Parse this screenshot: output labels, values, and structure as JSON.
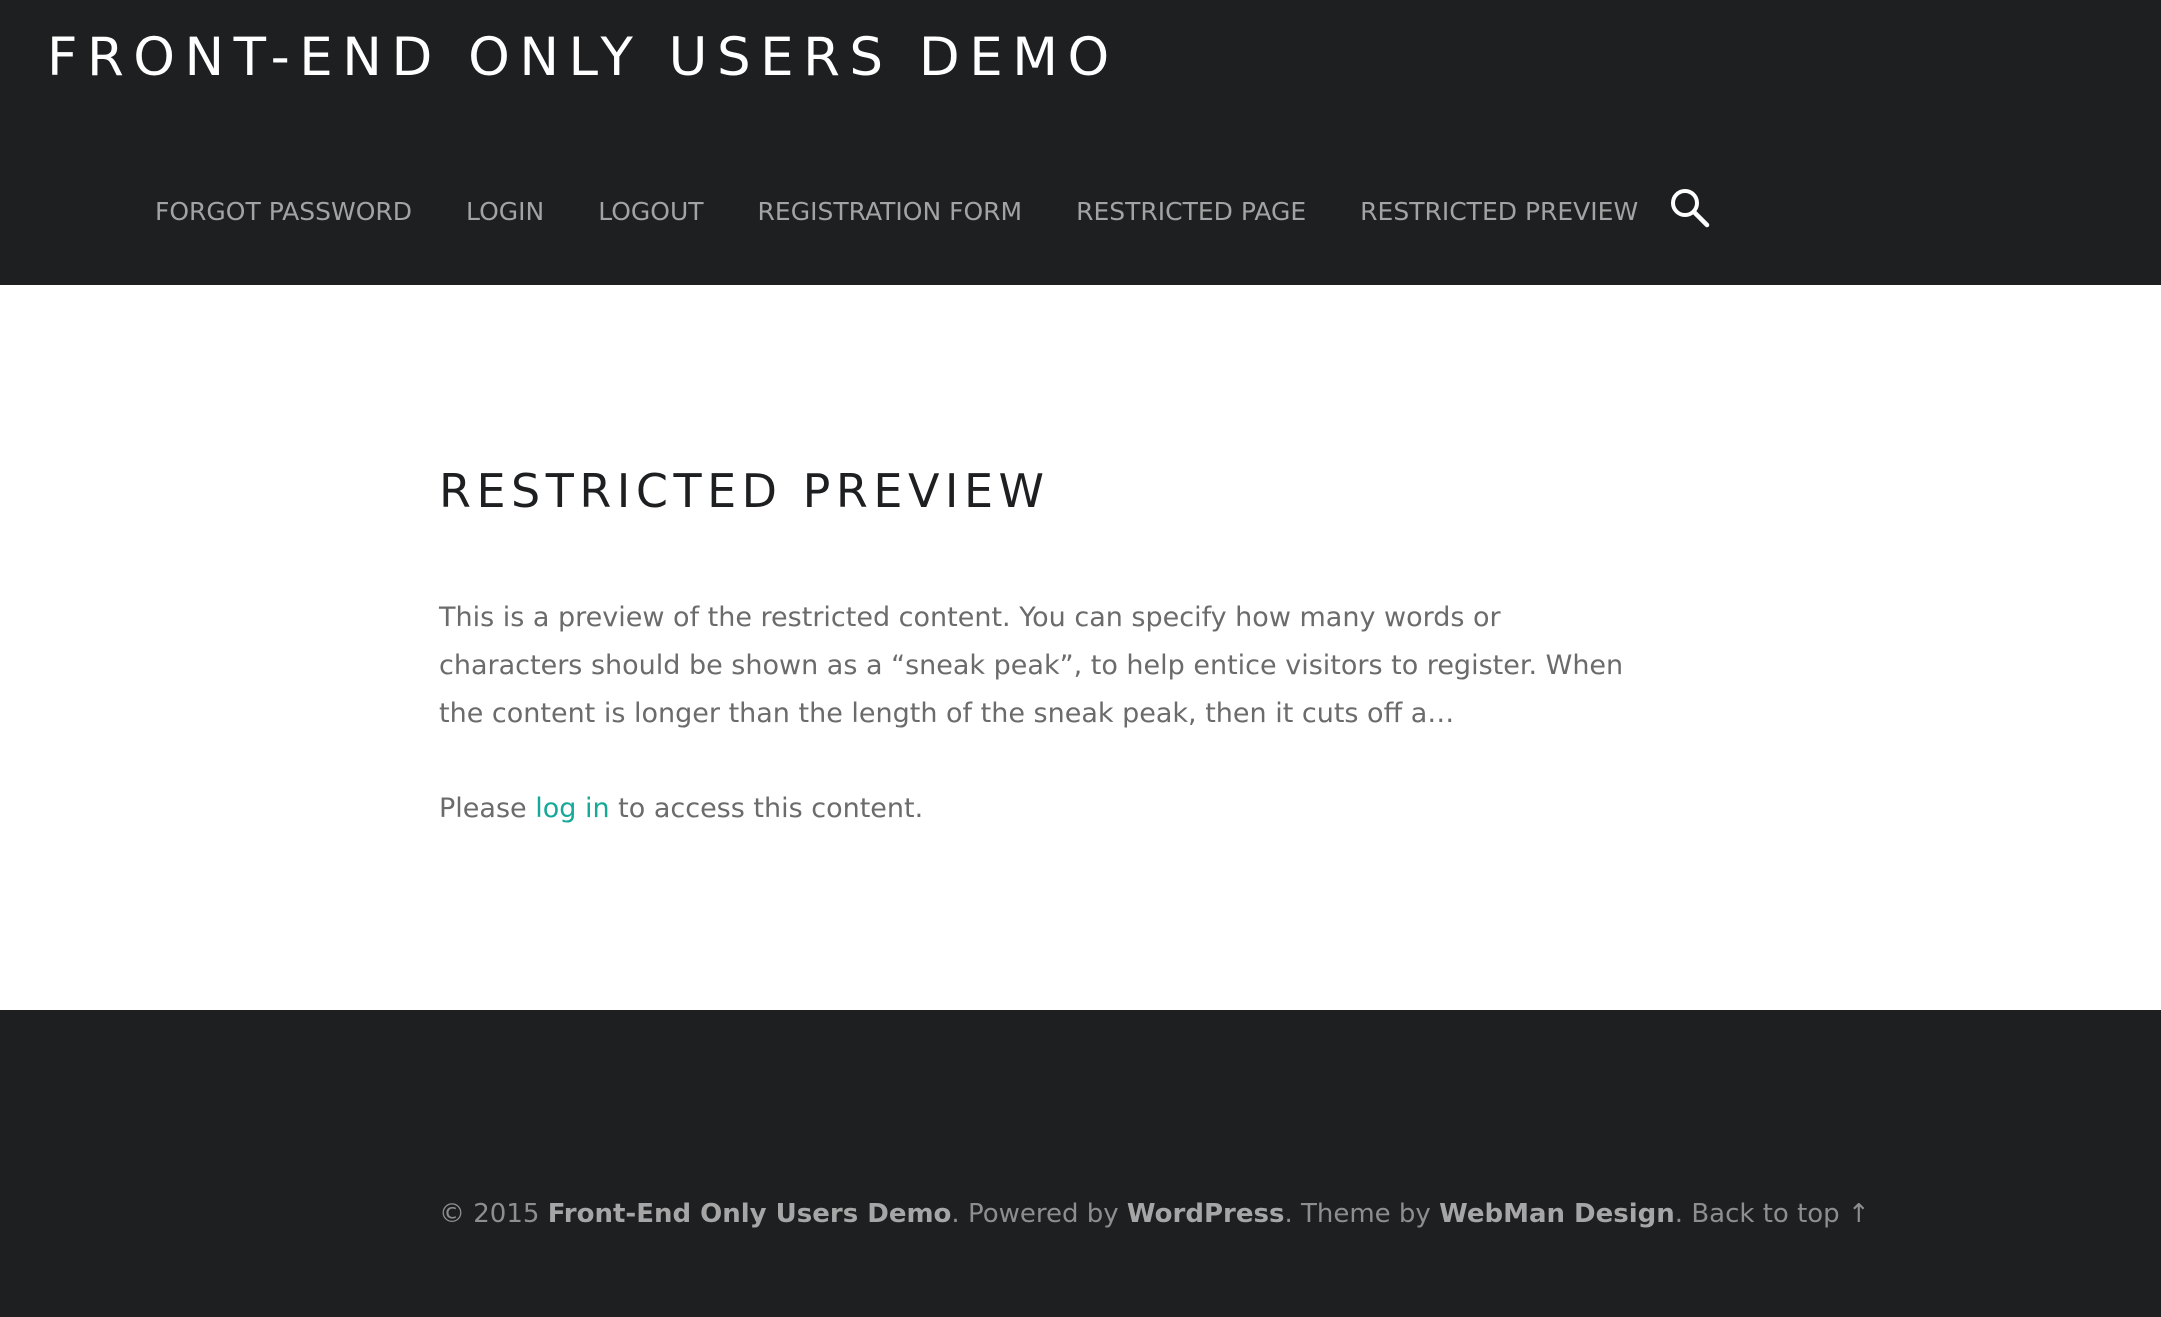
{
  "header": {
    "site_title": "FRONT-END ONLY USERS DEMO",
    "nav": [
      {
        "label": "FORGOT PASSWORD"
      },
      {
        "label": "LOGIN"
      },
      {
        "label": "LOGOUT"
      },
      {
        "label": "REGISTRATION FORM"
      },
      {
        "label": "RESTRICTED PAGE"
      },
      {
        "label": "RESTRICTED PREVIEW"
      }
    ],
    "search_icon": "search-icon"
  },
  "main": {
    "title": "RESTRICTED PREVIEW",
    "excerpt": "This is a preview of the restricted content. You can specify how many words or characters should be shown as a “sneak peak”, to help entice visitors to register. When the content is longer than the length of the sneak peak, then it cuts off a…",
    "login_prefix": "Please ",
    "login_link": "log in",
    "login_suffix": " to access this content."
  },
  "footer": {
    "copyright": "© 2015 ",
    "site_name": "Front-End Only Users Demo",
    "powered_by_text": ". Powered by ",
    "wordpress": "WordPress",
    "theme_by_text": ". Theme by ",
    "theme_author": "WebMan Design",
    "separator": ". ",
    "back_to_top": "Back to top ↑"
  },
  "colors": {
    "header_bg": "#1e1f21",
    "accent": "#16a99a",
    "nav_text": "#a3a3a3",
    "body_text": "#6b6b6b"
  }
}
